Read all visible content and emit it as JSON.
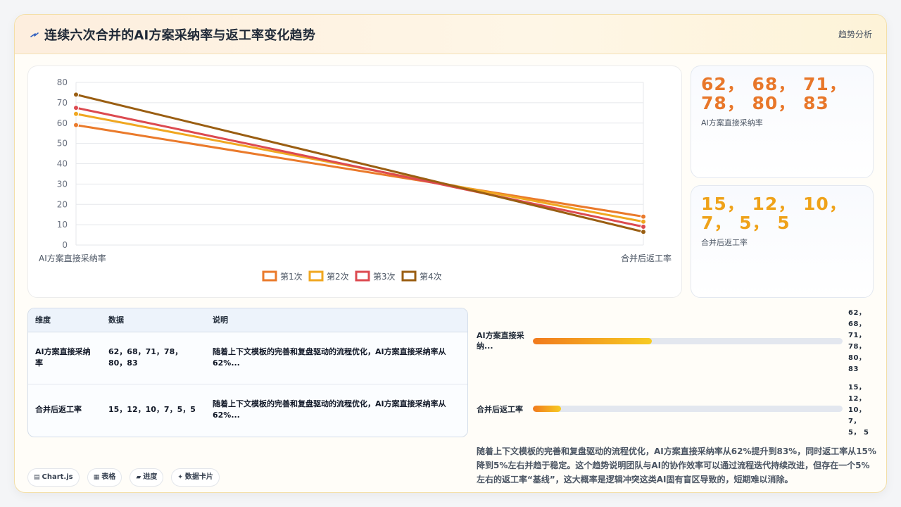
{
  "header": {
    "title": "连续六次合并的AI方案采纳率与返工率变化趋势",
    "action_label": "趋势分析"
  },
  "colors": {
    "accent": "#e8772a",
    "accent_alt": "#efa219",
    "series": [
      "#ea7a2b",
      "#f0a720",
      "#dc4a50",
      "#9a5e12"
    ]
  },
  "chart_data": {
    "type": "line",
    "title": "",
    "xlabel": "",
    "ylabel": "",
    "categories": [
      "AI方案直接采纳率",
      "合并后返工率"
    ],
    "ylim": [
      0,
      80
    ],
    "yticks": [
      0,
      10,
      20,
      30,
      40,
      50,
      60,
      70,
      80
    ],
    "grid": true,
    "legend_position": "bottom",
    "series": [
      {
        "name": "第1次",
        "values": [
          59,
          14
        ]
      },
      {
        "name": "第2次",
        "values": [
          64.5,
          11.5
        ]
      },
      {
        "name": "第3次",
        "values": [
          67.5,
          9
        ]
      },
      {
        "name": "第4次",
        "values": [
          74,
          6.5
        ]
      }
    ]
  },
  "stats": [
    {
      "value": "62， 68， 71， 78， 80， 83",
      "label": "AI方案直接采纳率"
    },
    {
      "value": "15， 12， 10， 7， 5， 5",
      "label": "合并后返工率"
    }
  ],
  "table": {
    "headers": [
      "维度",
      "数据",
      "说明"
    ],
    "rows": [
      {
        "dim": "AI方案直接采纳率",
        "data": "62，68，71，78，80，83",
        "note": "随着上下文模板的完善和复盘驱动的流程优化，AI方案直接采纳率从62%..."
      },
      {
        "dim": "合并后返工率",
        "data": "15，12，10，7，5，5",
        "note": "随着上下文模板的完善和复盘驱动的流程优化，AI方案直接采纳率从62%..."
      }
    ]
  },
  "progress": [
    {
      "label": "AI方案直接采纳...",
      "value_text": "62， 68， 71， 78， 80， 83",
      "fraction": 0.385
    },
    {
      "label": "合并后返工率",
      "value_text": "15， 12， 10， 7， 5， 5",
      "fraction": 0.092
    }
  ],
  "chips": [
    {
      "icon": "▤",
      "label": "Chart.js"
    },
    {
      "icon": "▦",
      "label": "表格"
    },
    {
      "icon": "▰",
      "label": "进度"
    },
    {
      "icon": "✦",
      "label": "数据卡片"
    }
  ],
  "summary": "随着上下文模板的完善和复盘驱动的流程优化，AI方案直接采纳率从62%提升到83%，同时返工率从15%降到5%左右并趋于稳定。这个趋势说明团队与AI的协作效率可以通过流程迭代持续改进，但存在一个5%左右的返工率“基线”，这大概率是逻辑冲突这类AI固有盲区导致的，短期难以消除。"
}
